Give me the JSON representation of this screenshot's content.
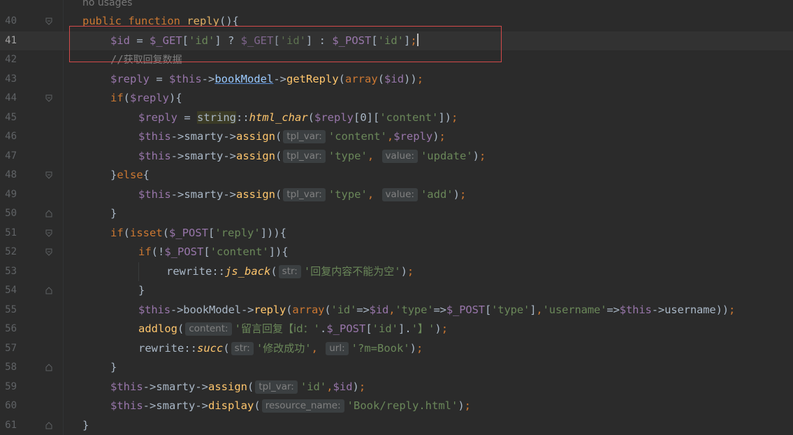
{
  "editor": {
    "usages_hint": "no usages",
    "current_line": "41",
    "colors": {
      "background": "#2b2b2b",
      "keyword": "#cc7832",
      "variable": "#9876aa",
      "function": "#ffc66d",
      "string": "#6a8759",
      "comment": "#808080",
      "highlight_box": "#d44a4a"
    },
    "lines": [
      {
        "num": "40",
        "fold": "open"
      },
      {
        "num": "41",
        "fold": "none"
      },
      {
        "num": "42",
        "fold": "none"
      },
      {
        "num": "43",
        "fold": "none"
      },
      {
        "num": "44",
        "fold": "open"
      },
      {
        "num": "45",
        "fold": "none"
      },
      {
        "num": "46",
        "fold": "none"
      },
      {
        "num": "47",
        "fold": "none"
      },
      {
        "num": "48",
        "fold": "open"
      },
      {
        "num": "49",
        "fold": "none"
      },
      {
        "num": "50",
        "fold": "close"
      },
      {
        "num": "51",
        "fold": "open"
      },
      {
        "num": "52",
        "fold": "open"
      },
      {
        "num": "53",
        "fold": "none"
      },
      {
        "num": "54",
        "fold": "close"
      },
      {
        "num": "55",
        "fold": "none"
      },
      {
        "num": "56",
        "fold": "none"
      },
      {
        "num": "57",
        "fold": "none"
      },
      {
        "num": "58",
        "fold": "close"
      },
      {
        "num": "59",
        "fold": "none"
      },
      {
        "num": "60",
        "fold": "none"
      },
      {
        "num": "61",
        "fold": "close"
      }
    ]
  },
  "hints": {
    "tpl_var": "tpl_var:",
    "value": "value:",
    "str": "str:",
    "content": "content:",
    "url": "url:",
    "resource_name": "resource_name:"
  },
  "code": {
    "l40_public": "public",
    "l40_function": "function",
    "l40_name": "reply",
    "l40_paren": "(){",
    "l41_id": "$id",
    "l41_eq": " = ",
    "l41_get": "$_GET",
    "l41_br1": "[",
    "l41_key": "'id'",
    "l41_br2": "] ? ",
    "l41_get2": "$_GET",
    "l41_br3": "[",
    "l41_key2": "'id'",
    "l41_br4": "] : ",
    "l41_post": "$_POST",
    "l41_br5": "[",
    "l41_key3": "'id'",
    "l41_br6": "]",
    "l41_semi": ";",
    "l42_comment": "//",
    "l42_comment_cn": "获取回复数据",
    "l43_reply": "$reply",
    "l43_eq": " = ",
    "l43_this": "$this",
    "l43_arrow": "->",
    "l43_model": "bookModel",
    "l43_arrow2": "->",
    "l43_fn": "getReply",
    "l43_p1": "(",
    "l43_array": "array",
    "l43_p2": "(",
    "l43_id": "$id",
    "l43_p3": "))",
    "l43_semi": ";",
    "l44_if": "if",
    "l44_p1": "(",
    "l44_reply": "$reply",
    "l44_p2": "){",
    "l45_reply": "$reply",
    "l45_eq": " = ",
    "l45_string": "string",
    "l45_dc": "::",
    "l45_fn": "html_char",
    "l45_p1": "(",
    "l45_reply2": "$reply",
    "l45_idx": "[0][",
    "l45_key": "'content'",
    "l45_p2": "])",
    "l45_semi": ";",
    "l46_this": "$this",
    "l46_a1": "->",
    "l46_smarty": "smarty",
    "l46_a2": "->",
    "l46_fn": "assign",
    "l46_p1": "(",
    "l46_key": "'content'",
    "l46_comma": ",",
    "l46_reply": "$reply",
    "l46_p2": ")",
    "l46_semi": ";",
    "l47_this": "$this",
    "l47_a1": "->",
    "l47_smarty": "smarty",
    "l47_a2": "->",
    "l47_fn": "assign",
    "l47_p1": "(",
    "l47_key": "'type'",
    "l47_comma": ", ",
    "l47_val": "'update'",
    "l47_p2": ")",
    "l47_semi": ";",
    "l48_close": "}",
    "l48_else": "else",
    "l48_open": "{",
    "l49_this": "$this",
    "l49_a1": "->",
    "l49_smarty": "smarty",
    "l49_a2": "->",
    "l49_fn": "assign",
    "l49_p1": "(",
    "l49_key": "'type'",
    "l49_comma": ", ",
    "l49_val": "'add'",
    "l49_p2": ")",
    "l49_semi": ";",
    "l50_close": "}",
    "l51_if": "if",
    "l51_p1": "(",
    "l51_isset": "isset",
    "l51_p2": "(",
    "l51_post": "$_POST",
    "l51_br1": "[",
    "l51_key": "'reply'",
    "l51_br2": "])){",
    "l52_if": "if",
    "l52_p1": "(!",
    "l52_post": "$_POST",
    "l52_br1": "[",
    "l52_key": "'content'",
    "l52_br2": "]){",
    "l53_rewrite": "rewrite",
    "l53_dc": "::",
    "l53_fn": "js_back",
    "l53_p1": "(",
    "l53_q1": "'",
    "l53_cn": "回复内容不能为空",
    "l53_q2": "'",
    "l53_p2": ")",
    "l53_semi": ";",
    "l54_close": "}",
    "l55_this": "$this",
    "l55_a1": "->",
    "l55_model": "bookModel",
    "l55_a2": "->",
    "l55_fn": "reply",
    "l55_p1": "(",
    "l55_array": "array",
    "l55_p2": "(",
    "l55_k1": "'id'",
    "l55_arr1": "=>",
    "l55_id": "$id",
    "l55_c1": ",",
    "l55_k2": "'type'",
    "l55_arr2": "=>",
    "l55_post": "$_POST",
    "l55_br1": "[",
    "l55_k3": "'type'",
    "l55_br2": "]",
    "l55_c2": ",",
    "l55_k4": "'username'",
    "l55_arr3": "=>",
    "l55_this2": "$this",
    "l55_a3": "->",
    "l55_uname": "username",
    "l55_p3": "))",
    "l55_semi": ";",
    "l56_fn": "addlog",
    "l56_p1": "(",
    "l56_q1": "'",
    "l56_cn": "留言回复【id：",
    "l56_q2": "'",
    "l56_dot1": ".",
    "l56_post": "$_POST",
    "l56_br1": "[",
    "l56_key": "'id'",
    "l56_br2": "]",
    "l56_dot2": ".",
    "l56_q3": "'",
    "l56_cn2": "】",
    "l56_q4": "'",
    "l56_p2": ")",
    "l56_semi": ";",
    "l57_rewrite": "rewrite",
    "l57_dc": "::",
    "l57_fn": "succ",
    "l57_p1": "(",
    "l57_q1": "'",
    "l57_cn": "修改成功",
    "l57_q2": "'",
    "l57_comma": ", ",
    "l57_url": "'?m=Book'",
    "l57_p2": ")",
    "l57_semi": ";",
    "l58_close": "}",
    "l59_this": "$this",
    "l59_a1": "->",
    "l59_smarty": "smarty",
    "l59_a2": "->",
    "l59_fn": "assign",
    "l59_p1": "(",
    "l59_key": "'id'",
    "l59_comma": ",",
    "l59_id": "$id",
    "l59_p2": ")",
    "l59_semi": ";",
    "l60_this": "$this",
    "l60_a1": "->",
    "l60_smarty": "smarty",
    "l60_a2": "->",
    "l60_fn": "display",
    "l60_p1": "(",
    "l60_val": "'Book/reply.html'",
    "l60_p2": ")",
    "l60_semi": ";",
    "l61_close": "}"
  }
}
